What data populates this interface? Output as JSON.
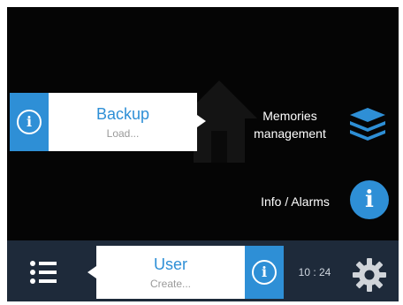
{
  "backup_popup": {
    "title": "Backup",
    "subtitle": "Load...",
    "icon": "info-icon"
  },
  "menu": [
    {
      "label": "Memories\nmanagement",
      "icon": "layers-icon"
    },
    {
      "label": "Info / Alarms",
      "icon": "info-icon"
    }
  ],
  "bottom_bar": {
    "menu_icon": "list-icon",
    "user_popup": {
      "title": "User",
      "subtitle": "Create...",
      "icon": "info-icon"
    },
    "clock": "10 : 24",
    "settings_icon": "gear-icon"
  },
  "colors": {
    "accent": "#2e8fd6",
    "background": "#050505",
    "bar": "#1e2a3a"
  }
}
